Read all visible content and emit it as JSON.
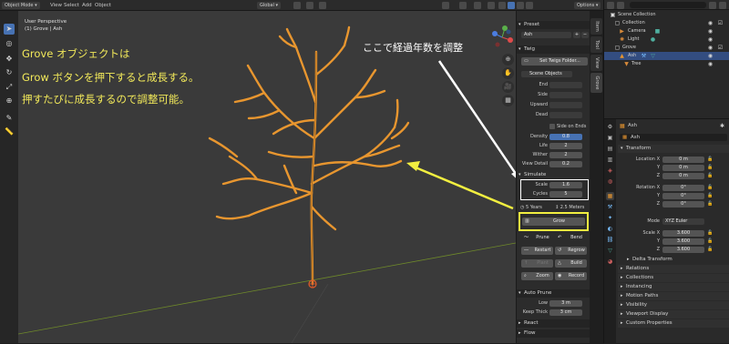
{
  "header": {
    "mode": "Object Mode",
    "menus": [
      "View",
      "Select",
      "Add",
      "Object"
    ],
    "orientation": "Global",
    "options": "Options"
  },
  "viewport": {
    "view_name": "User Perspective",
    "object_label": "(1) Grove | Ash",
    "annotation_left": [
      "Grove オブジェクトは",
      "Grow ボタンを押下すると成長する。",
      "押すたびに成長するので調整可能。"
    ],
    "annotation_right": "ここで経過年数を調整"
  },
  "sidebar_tabs": [
    "Item",
    "Tool",
    "View",
    "Grove"
  ],
  "npanel": {
    "preset_header": "Preset",
    "preset_value": "Ash",
    "twig_header": "Twig",
    "twig_button": "Set Twigs Folder...",
    "scene_objects": "Scene Objects",
    "twig_fields": [
      "End",
      "Side",
      "Upward",
      "Dead"
    ],
    "side_on_ends": "Side on Ends",
    "params": [
      {
        "label": "Density",
        "value": "0.8",
        "highlight": true
      },
      {
        "label": "Life",
        "value": "2"
      },
      {
        "label": "Wither",
        "value": "2"
      },
      {
        "label": "View Detail",
        "value": "0.2"
      }
    ],
    "simulate_header": "Simulate",
    "simulate": [
      {
        "label": "Scale",
        "value": "1.6"
      },
      {
        "label": "Cycles",
        "value": "5"
      }
    ],
    "years": "5 Years",
    "meters": "2.5 Meters",
    "grow": "Grow",
    "actions": [
      {
        "icon": "prune",
        "label": "Prune"
      },
      {
        "icon": "bend",
        "label": "Bend"
      },
      {
        "icon": "restart",
        "label": "Restart"
      },
      {
        "icon": "regrow",
        "label": "Regrow"
      },
      {
        "icon": "plant",
        "label": "Plant"
      },
      {
        "icon": "build",
        "label": "Build"
      },
      {
        "icon": "zoom",
        "label": "Zoom"
      },
      {
        "icon": "record",
        "label": "Record"
      }
    ],
    "auto_prune_header": "Auto Prune",
    "auto_prune": [
      {
        "label": "Low",
        "value": "3 m"
      },
      {
        "label": "Keep Thick",
        "value": "3 cm"
      }
    ],
    "react_header": "React",
    "flow_header": "Flow"
  },
  "outliner": {
    "rows": [
      {
        "label": "Scene Collection",
        "icon": "scene-collection-icon",
        "indent": 0
      },
      {
        "label": "Collection",
        "icon": "collection-icon",
        "indent": 1
      },
      {
        "label": "Camera",
        "icon": "camera-icon",
        "indent": 2
      },
      {
        "label": "Light",
        "icon": "light-icon",
        "indent": 2
      },
      {
        "label": "Grove",
        "icon": "collection-icon",
        "indent": 1
      },
      {
        "label": "Ash",
        "icon": "object-icon",
        "indent": 2,
        "selected": true
      },
      {
        "label": "Tree",
        "icon": "mesh-icon",
        "indent": 3
      }
    ]
  },
  "properties": {
    "object_tab": "Ash",
    "object_name": "Ash",
    "transform_header": "Transform",
    "location_label": "Location X",
    "location": [
      "0 m",
      "0 m",
      "0 m"
    ],
    "rotation_label": "Rotation X",
    "rotation": [
      "0°",
      "0°",
      "0°"
    ],
    "mode_label": "Mode",
    "mode_value": "XYZ Euler",
    "scale_label": "Scale X",
    "scale": [
      "3.600",
      "3.600",
      "3.600"
    ],
    "axis_labels": [
      "Y",
      "Z"
    ],
    "delta_header": "Delta Transform",
    "sections": [
      "Relations",
      "Collections",
      "Instancing",
      "Motion Paths",
      "Visibility",
      "Viewport Display",
      "Custom Properties"
    ]
  },
  "colors": {
    "branch": "#e8962f",
    "annotation_text": "#f2e95a",
    "annotation_arrow": "#f2ef40",
    "highlight_box": "#ffffff",
    "grow_box": "#f2ef40",
    "accent": "#4772b3"
  }
}
